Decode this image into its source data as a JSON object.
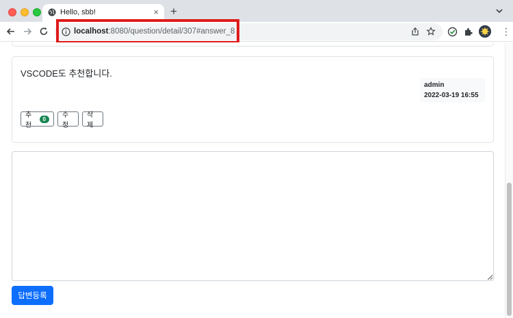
{
  "browser": {
    "tab_title": "Hello, sbb!",
    "new_tab_symbol": "+",
    "close_symbol": "×",
    "url_host": "localhost",
    "url_rest": ":8080/question/detail/307#answer_8",
    "highlight_color": "#e01b1b"
  },
  "answer": {
    "content": "VSCODE도 추천합니다.",
    "author": "admin",
    "created": "2022-03-19 16:55",
    "vote_label": "추천",
    "vote_count": "0",
    "modify_label": "수정",
    "delete_label": "삭제"
  },
  "answer_form": {
    "content_value": "",
    "submit_label": "답변등록"
  },
  "colors": {
    "primary": "#0d6efd",
    "success_badge": "#198754",
    "border": "#dee2e6"
  }
}
